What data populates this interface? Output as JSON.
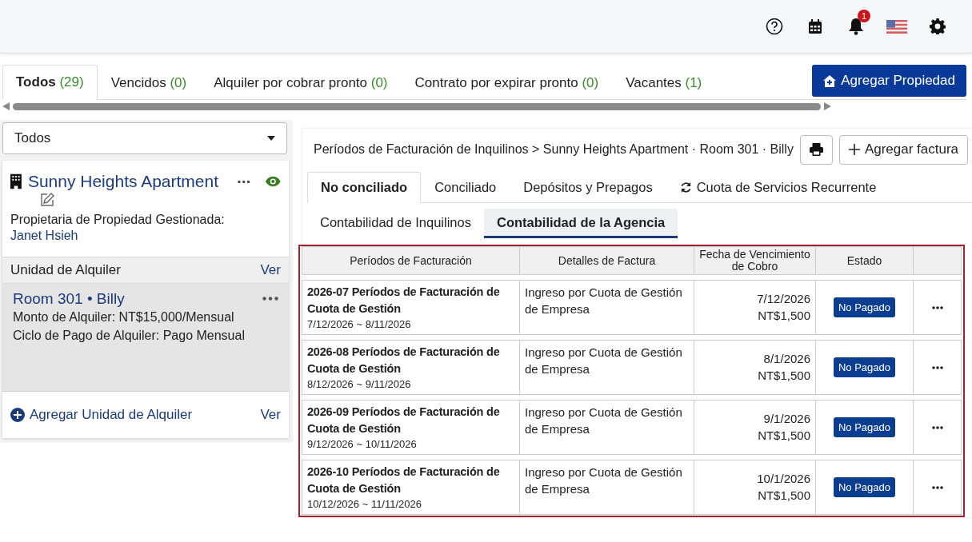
{
  "header": {
    "notification_count": "1"
  },
  "status_tabs": [
    {
      "label": "Todos",
      "count": "(29)",
      "selected": true
    },
    {
      "label": "Vencidos",
      "count": "(0)",
      "selected": false
    },
    {
      "label": "Alquiler por cobrar pronto",
      "count": "(0)",
      "selected": false
    },
    {
      "label": "Contrato por expirar pronto",
      "count": "(0)",
      "selected": false
    },
    {
      "label": "Vacantes",
      "count": "(1)",
      "selected": false
    }
  ],
  "add_property_button": "Agregar Propiedad",
  "filter_select": {
    "value": "Todos"
  },
  "property": {
    "name": "Sunny Heights Apartment",
    "owner_label": "Propietaria de Propiedad Gestionada:",
    "owner_name": "Janet Hsieh",
    "units_heading": "Unidad de Alquiler",
    "units_link": "Ver",
    "units": [
      {
        "name": "Room 301 • Billy",
        "rent": "Monto de Alquiler: NT$15,000/Mensual",
        "cycle": "Ciclo de Pago de Alquiler: Pago Mensual",
        "selected": true
      }
    ],
    "add_unit": "Agregar Unidad de Alquiler",
    "add_unit_link": "Ver"
  },
  "billing": {
    "breadcrumb": "Períodos de Facturación de Inquilinos > Sunny Heights Apartment · Room 301 · Billy",
    "add_invoice": "Agregar factura",
    "tabs": [
      {
        "label": "No conciliado",
        "kind": "plain",
        "selected": true
      },
      {
        "label": "Conciliado",
        "kind": "plain",
        "selected": false
      },
      {
        "label": "Depósitos y Prepagos",
        "kind": "plain",
        "selected": false
      },
      {
        "label": "Cuota de Servicios Recurrente",
        "kind": "recurring",
        "selected": false
      }
    ],
    "subtabs": [
      {
        "label": "Contabilidad de Inquilinos",
        "selected": false
      },
      {
        "label": "Contabilidad de la Agencia",
        "selected": true
      }
    ],
    "table": {
      "columns": [
        "Períodos de Facturación",
        "Detalles de Factura",
        "Fecha de Vencimiento de Cobro",
        "Estado"
      ],
      "rows": [
        {
          "period": "2026-07 Períodos de Facturación de Cuota de Gestión",
          "range": "7/12/2026 ~ 8/11/2026",
          "details": "Ingreso por Cuota de Gestión de Empresa",
          "due_date": "7/12/2026",
          "amount": "NT$1,500",
          "status": "No Pagado"
        },
        {
          "period": "2026-08 Períodos de Facturación de Cuota de Gestión",
          "range": "8/12/2026 ~ 9/11/2026",
          "details": "Ingreso por Cuota de Gestión de Empresa",
          "due_date": "8/1/2026",
          "amount": "NT$1,500",
          "status": "No Pagado"
        },
        {
          "period": "2026-09 Períodos de Facturación de Cuota de Gestión",
          "range": "9/12/2026 ~ 10/11/2026",
          "details": "Ingreso por Cuota de Gestión de Empresa",
          "due_date": "9/1/2026",
          "amount": "NT$1,500",
          "status": "No Pagado"
        },
        {
          "period": "2026-10 Períodos de Facturación de Cuota de Gestión",
          "range": "10/12/2026 ~ 11/11/2026",
          "details": "Ingreso por Cuota de Gestión de Empresa",
          "due_date": "10/1/2026",
          "amount": "NT$1,500",
          "status": "No Pagado"
        }
      ]
    }
  }
}
